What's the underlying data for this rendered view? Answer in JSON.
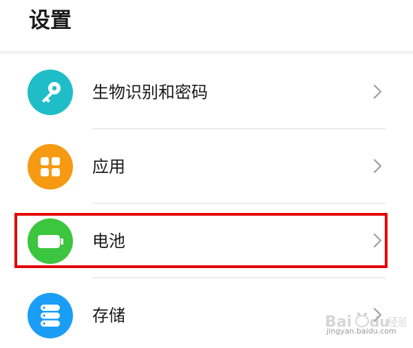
{
  "header": {
    "title": "设置"
  },
  "settings_items": [
    {
      "label": "生物识别和密码",
      "icon": "key-icon",
      "color": "#1fbdc7"
    },
    {
      "label": "应用",
      "icon": "apps-grid-icon",
      "color": "#f59a12"
    },
    {
      "label": "电池",
      "icon": "battery-icon",
      "color": "#3cc53e"
    },
    {
      "label": "存储",
      "icon": "storage-icon",
      "color": "#1a9ef5"
    }
  ],
  "annotation": {
    "highlight_color": "#e50000",
    "highlighted_item": "电池"
  },
  "watermark": {
    "logo": "Bai du 经验",
    "url": "jingyan.baidu.com"
  }
}
